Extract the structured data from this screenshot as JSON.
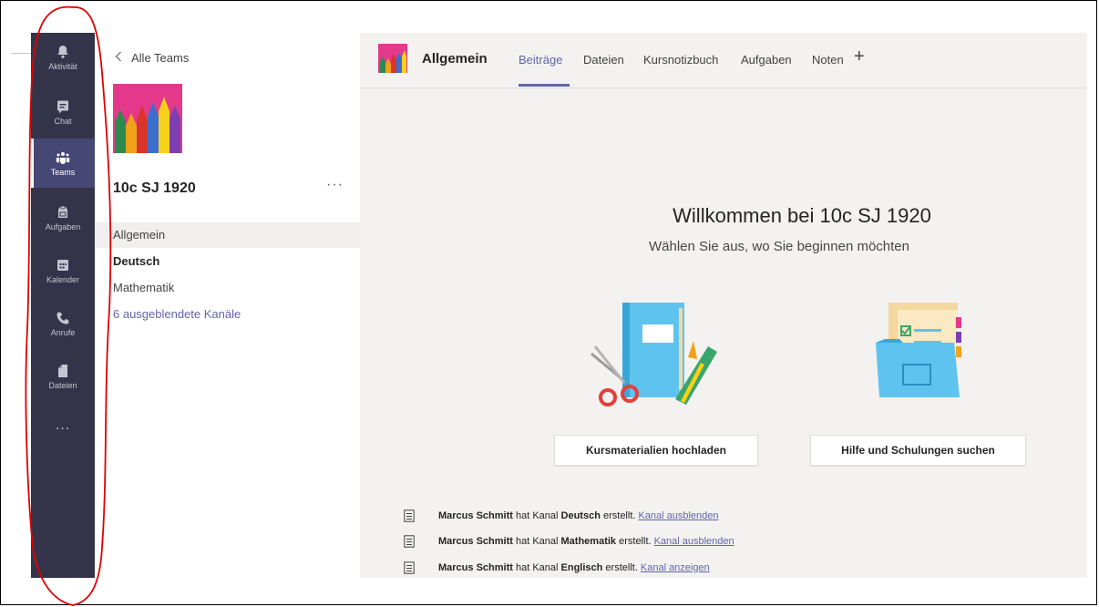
{
  "rail": {
    "items": [
      {
        "label": "Aktivität",
        "icon": "bell-icon"
      },
      {
        "label": "Chat",
        "icon": "chat-icon"
      },
      {
        "label": "Teams",
        "icon": "teams-icon"
      },
      {
        "label": "Aufgaben",
        "icon": "assignments-icon"
      },
      {
        "label": "Kalender",
        "icon": "calendar-icon"
      },
      {
        "label": "Anrufe",
        "icon": "phone-icon"
      },
      {
        "label": "Dateien",
        "icon": "file-icon"
      }
    ],
    "more": "...",
    "active_index": 2
  },
  "pane": {
    "back_label": "Alle Teams",
    "team_name": "10c SJ 1920",
    "more": "···",
    "channels": [
      {
        "label": "Allgemein"
      },
      {
        "label": "Deutsch"
      },
      {
        "label": "Mathematik"
      }
    ],
    "hidden_channels": "6 ausgeblendete Kanäle"
  },
  "header": {
    "title": "Allgemein",
    "tabs": [
      "Beiträge",
      "Dateien",
      "Kursnotizbuch",
      "Aufgaben",
      "Noten"
    ],
    "add": "+"
  },
  "welcome": {
    "title": "Willkommen bei 10c SJ 1920",
    "subtitle": "Wählen Sie aus, wo Sie beginnen möchten",
    "upload_button": "Kursmaterialien hochladen",
    "help_button": "Hilfe und Schulungen suchen"
  },
  "activity": [
    {
      "user": "Marcus Schmitt",
      "mid": " hat Kanal ",
      "channel": "Deutsch",
      "tail": " erstellt.",
      "link": "Kanal ausblenden"
    },
    {
      "user": "Marcus Schmitt",
      "mid": " hat Kanal ",
      "channel": "Mathematik",
      "tail": " erstellt.",
      "link": "Kanal ausblenden"
    },
    {
      "user": "Marcus Schmitt",
      "mid": " hat Kanal ",
      "channel": "Englisch",
      "tail": " erstellt.",
      "link": "Kanal anzeigen"
    }
  ],
  "colors": {
    "rail": "#33344a",
    "accent": "#6264a7",
    "team_pink": "#e4398a",
    "annotation": "#e00000"
  }
}
